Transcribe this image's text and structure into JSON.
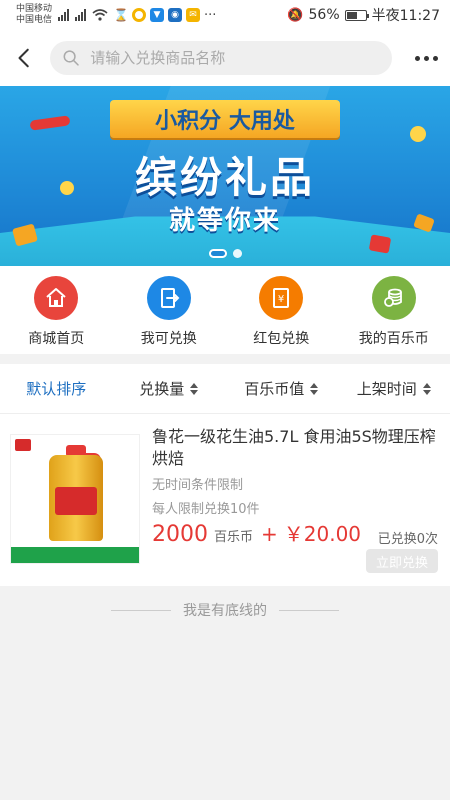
{
  "status_bar": {
    "carrier_1": "中国移动",
    "carrier_2": "中国电信",
    "battery": "56%",
    "time": "半夜11:27"
  },
  "nav": {
    "search_placeholder": "请输入兑换商品名称"
  },
  "banner": {
    "ribbon": "小积分 大用处",
    "title": "缤纷礼品",
    "subtitle": "就等你来",
    "slide_index": 1,
    "slide_count": 2
  },
  "quick_links": [
    {
      "label": "商城首页",
      "icon": "home-icon",
      "color": "#e8453c"
    },
    {
      "label": "我可兑换",
      "icon": "exchange-icon",
      "color": "#1e88e5"
    },
    {
      "label": "红包兑换",
      "icon": "red-packet-icon",
      "color": "#f57c00"
    },
    {
      "label": "我的百乐币",
      "icon": "coins-icon",
      "color": "#7cb342"
    }
  ],
  "sort_bar": [
    {
      "label": "默认排序",
      "active": true
    },
    {
      "label": "兑换量",
      "active": false
    },
    {
      "label": "百乐币值",
      "active": false
    },
    {
      "label": "上架时间",
      "active": false
    }
  ],
  "product": {
    "title": "鲁花一级花生油5.7L 食用油5S物理压榨烘焙",
    "time_limit": "无时间条件限制",
    "per_person_limit": "每人限制兑换10件",
    "points": "2000",
    "points_unit": "百乐币",
    "plus": "+",
    "cash": "￥20.00",
    "redeemed": "已兑换0次",
    "redeem_button": "立即兑换"
  },
  "footer": {
    "end_text": "我是有底线的"
  },
  "colors": {
    "accent_blue": "#1e6fc1",
    "price_red": "#e53935"
  }
}
